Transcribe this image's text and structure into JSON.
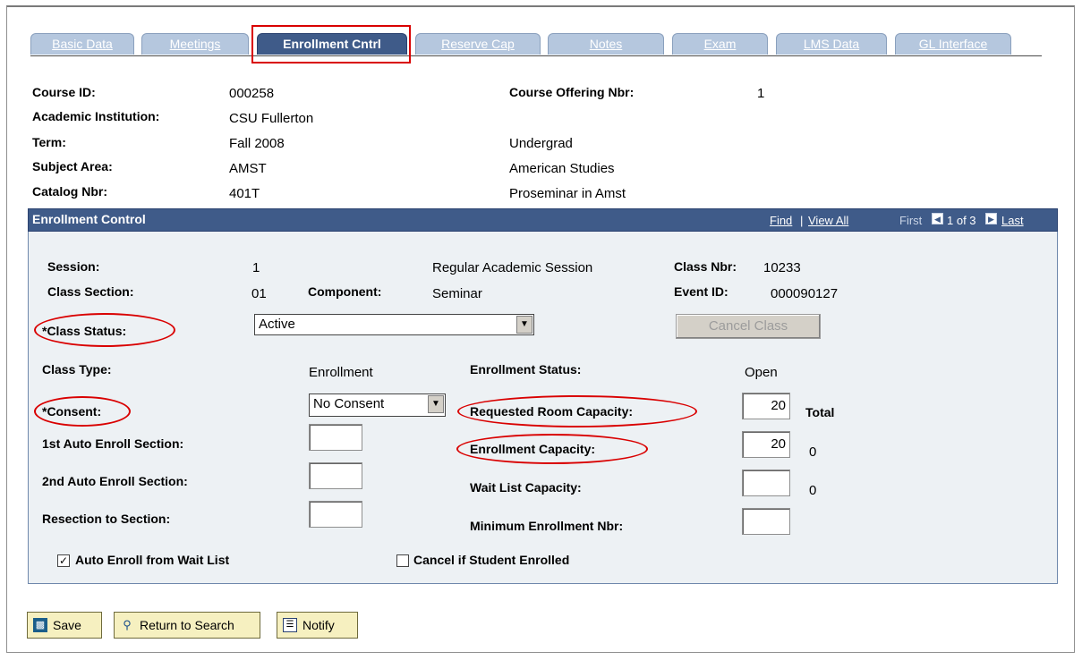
{
  "tabs": [
    "Basic Data",
    "Meetings",
    "Enrollment Cntrl",
    "Reserve Cap",
    "Notes",
    "Exam",
    "LMS Data",
    "GL Interface"
  ],
  "header": {
    "course_id_label": "Course ID:",
    "course_id": "000258",
    "institution_label": "Academic Institution:",
    "institution": "CSU Fullerton",
    "term_label": "Term:",
    "term": "Fall 2008",
    "career": "Undergrad",
    "subject_label": "Subject Area:",
    "subject": "AMST",
    "subject_desc": "American Studies",
    "catalog_label": "Catalog Nbr:",
    "catalog": "401T",
    "catalog_desc": "Proseminar in Amst",
    "offering_label": "Course Offering Nbr:",
    "offering": "1"
  },
  "grid": {
    "title": "Enrollment Control",
    "find": "Find",
    "sep": "|",
    "view_all": "View All",
    "first": "First",
    "page": "1 of 3",
    "last": "Last"
  },
  "form": {
    "session_label": "Session:",
    "session": "1",
    "session_desc": "Regular Academic Session",
    "class_nbr_label": "Class Nbr:",
    "class_nbr": "10233",
    "section_label": "Class Section:",
    "section": "01",
    "component_label": "Component:",
    "component": "Seminar",
    "event_label": "Event ID:",
    "event": "000090127",
    "status_label": "*Class Status:",
    "status": "Active",
    "cancel_class": "Cancel Class",
    "type_label": "Class Type:",
    "type": "Enrollment",
    "enroll_status_label": "Enrollment Status:",
    "enroll_status": "Open",
    "consent_label": "*Consent:",
    "consent": "No Consent",
    "room_cap_label": "Requested Room Capacity:",
    "room_cap": "20",
    "total": "Total",
    "auto1_label": "1st Auto Enroll Section:",
    "enroll_cap_label": "Enrollment Capacity:",
    "enroll_cap": "20",
    "enroll_total": "0",
    "auto2_label": "2nd Auto Enroll Section:",
    "wait_label": "Wait List Capacity:",
    "wait_total": "0",
    "resection_label": "Resection to Section:",
    "min_label": "Minimum Enrollment Nbr:",
    "auto_wait_label": "Auto Enroll from Wait List",
    "cancel_enrolled_label": "Cancel if Student Enrolled"
  },
  "toolbar": {
    "save": "Save",
    "return": "Return to Search",
    "notify": "Notify"
  },
  "colors": {
    "tab": "#b5c7de",
    "tab_active": "#3f5b89",
    "annotation": "#d90000",
    "button": "#f6f0c0"
  }
}
